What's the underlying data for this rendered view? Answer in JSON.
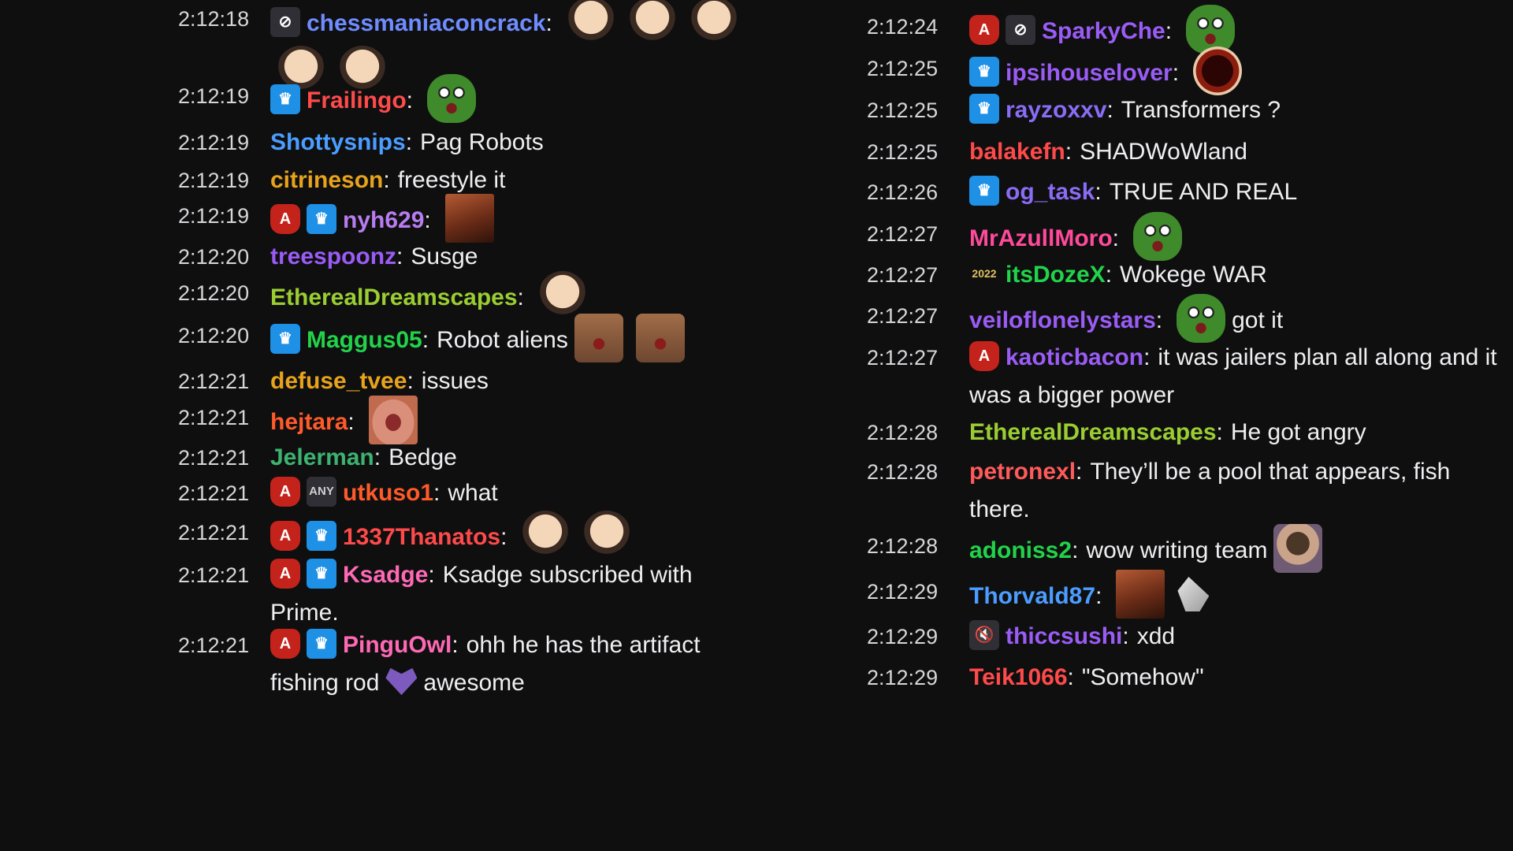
{
  "chat_left": [
    {
      "time": "2:12:18",
      "badges": [
        {
          "type": "mute",
          "icon": "eye-slash-icon",
          "glyph": "⊘"
        }
      ],
      "user": "chessmaniaconcrack",
      "color": "#6f8cff",
      "emotes_after": [
        "face",
        "face",
        "face",
        "face",
        "face"
      ]
    },
    {
      "time": "2:12:19",
      "badges": [
        {
          "type": "sub",
          "icon": "crown-icon",
          "glyph": "♛"
        }
      ],
      "user": "Frailingo",
      "color": "#ff4a4a",
      "emotes_after": [
        "frog"
      ]
    },
    {
      "time": "2:12:19",
      "badges": [],
      "user": "Shottysnips",
      "color": "#4b9dff",
      "text": "Pag Robots"
    },
    {
      "time": "2:12:19",
      "badges": [],
      "user": "citrineson",
      "color": "#e7a31c",
      "text": "freestyle it"
    },
    {
      "time": "2:12:19",
      "badges": [
        {
          "type": "anniv",
          "icon": "anniversary-icon",
          "glyph": "A"
        },
        {
          "type": "sub",
          "icon": "crown-icon",
          "glyph": "♛"
        }
      ],
      "user": "nyh629",
      "color": "#b87cf0",
      "emotes_after": [
        "photo"
      ]
    },
    {
      "time": "2:12:20",
      "badges": [],
      "user": "treespoonz",
      "color": "#9a5cf5",
      "text": "Susge"
    },
    {
      "time": "2:12:20",
      "badges": [],
      "user": "EtherealDreamscapes",
      "color": "#9acd32",
      "emotes_after": [
        "face"
      ]
    },
    {
      "time": "2:12:20",
      "badges": [
        {
          "type": "sub",
          "icon": "crown-icon",
          "glyph": "♛"
        }
      ],
      "user": "Maggus05",
      "color": "#22d34a",
      "text": "Robot aliens",
      "emotes_after": [
        "cat",
        "cat"
      ]
    },
    {
      "time": "2:12:21",
      "badges": [],
      "user": "defuse_tvee",
      "color": "#e7a31c",
      "text": "issues"
    },
    {
      "time": "2:12:21",
      "badges": [],
      "user": "hejtara",
      "color": "#ff5a2a",
      "emotes_after": [
        "lips"
      ]
    },
    {
      "time": "2:12:21",
      "badges": [],
      "user": "Jelerman",
      "color": "#3cb371",
      "text": "Bedge"
    },
    {
      "time": "2:12:21",
      "badges": [
        {
          "type": "anniv",
          "icon": "anniversary-icon",
          "glyph": "A"
        },
        {
          "type": "turbo",
          "icon": "any-badge-icon",
          "glyph": "ANY"
        }
      ],
      "user": "utkuso1",
      "color": "#ff5a2a",
      "text": "what"
    },
    {
      "time": "2:12:21",
      "badges": [
        {
          "type": "anniv",
          "icon": "anniversary-icon",
          "glyph": "A"
        },
        {
          "type": "sub",
          "icon": "crown-icon",
          "glyph": "♛"
        }
      ],
      "user": "1337Thanatos",
      "color": "#ff4a4a",
      "emotes_after": [
        "face",
        "face"
      ]
    },
    {
      "time": "2:12:21",
      "badges": [
        {
          "type": "anniv",
          "icon": "anniversary-icon",
          "glyph": "A"
        },
        {
          "type": "sub",
          "icon": "crown-icon",
          "glyph": "♛"
        }
      ],
      "user": "Ksadge",
      "color": "#ff69b4",
      "text": "Ksadge subscribed with Prime."
    },
    {
      "time": "2:12:21",
      "badges": [
        {
          "type": "anniv",
          "icon": "anniversary-icon",
          "glyph": "A"
        },
        {
          "type": "sub",
          "icon": "crown-icon",
          "glyph": "♛"
        }
      ],
      "user": "PinguOwl",
      "color": "#ff69b4",
      "text": "ohh he has the artifact fishing rod",
      "emotes_inline": [
        "heart"
      ],
      "text2": "awesome"
    }
  ],
  "chat_right": [
    {
      "time": "2:12:24",
      "badges": [
        {
          "type": "anniv",
          "icon": "anniversary-icon",
          "glyph": "A"
        },
        {
          "type": "mute",
          "icon": "eye-slash-icon",
          "glyph": "⊘"
        }
      ],
      "user": "SparkyChe",
      "color": "#9a5cf5",
      "emotes_after": [
        "frog"
      ]
    },
    {
      "time": "2:12:25",
      "badges": [
        {
          "type": "sub",
          "icon": "crown-icon",
          "glyph": "♛"
        }
      ],
      "user": "ipsihouselover",
      "color": "#9a5cf5",
      "emotes_after": [
        "hole"
      ]
    },
    {
      "time": "2:12:25",
      "badges": [
        {
          "type": "sub",
          "icon": "crown-icon",
          "glyph": "♛"
        }
      ],
      "user": "rayzoxxv",
      "color": "#8a6cf5",
      "text": "Transformers ?"
    },
    {
      "time": "2:12:25",
      "badges": [],
      "user": "balakefn",
      "color": "#ff4a4a",
      "text": "SHADWoWland"
    },
    {
      "time": "2:12:26",
      "badges": [
        {
          "type": "sub",
          "icon": "crown-icon",
          "glyph": "♛"
        }
      ],
      "user": "og_task",
      "color": "#8a6cf5",
      "text": "TRUE AND REAL"
    },
    {
      "time": "2:12:27",
      "badges": [],
      "user": "MrAzullMoro",
      "color": "#ff4a9a",
      "emotes_after": [
        "frog"
      ]
    },
    {
      "time": "2:12:27",
      "badges": [
        {
          "type": "year",
          "icon": "2022-badge-icon",
          "glyph": "2022"
        }
      ],
      "user": "itsDozeX",
      "color": "#22d34a",
      "text": "Wokege WAR"
    },
    {
      "time": "2:12:27",
      "badges": [],
      "user": "veiloflonelystars",
      "color": "#9a5cf5",
      "emotes_after": [
        "frog"
      ],
      "text2": "got it"
    },
    {
      "time": "2:12:27",
      "badges": [
        {
          "type": "anniv",
          "icon": "anniversary-icon",
          "glyph": "A"
        }
      ],
      "user": "kaoticbacon",
      "color": "#9a5cf5",
      "text": "it was jailers plan all along and it was a bigger power"
    },
    {
      "time": "2:12:28",
      "badges": [],
      "user": "EtherealDreamscapes",
      "color": "#9acd32",
      "text": "He got angry"
    },
    {
      "time": "2:12:28",
      "badges": [],
      "user": "petronexl",
      "color": "#ff5a5a",
      "text": "They’ll be a pool that appears, fish there."
    },
    {
      "time": "2:12:28",
      "badges": [],
      "user": "adoniss2",
      "color": "#22d34a",
      "text": "wow writing team",
      "emotes_after": [
        "hands"
      ]
    },
    {
      "time": "2:12:29",
      "badges": [],
      "user": "Thorvald87",
      "color": "#4b9dff",
      "emotes_after": [
        "photo",
        "clap"
      ]
    },
    {
      "time": "2:12:29",
      "badges": [
        {
          "type": "mute",
          "icon": "speaker-mute-icon",
          "glyph": "🔇"
        }
      ],
      "user": "thiccsushi",
      "color": "#9a5cf5",
      "text": "xdd"
    },
    {
      "time": "2:12:29",
      "badges": [],
      "user": "Teik1066",
      "color": "#ff4a4a",
      "text": "\"Somehow\""
    }
  ]
}
